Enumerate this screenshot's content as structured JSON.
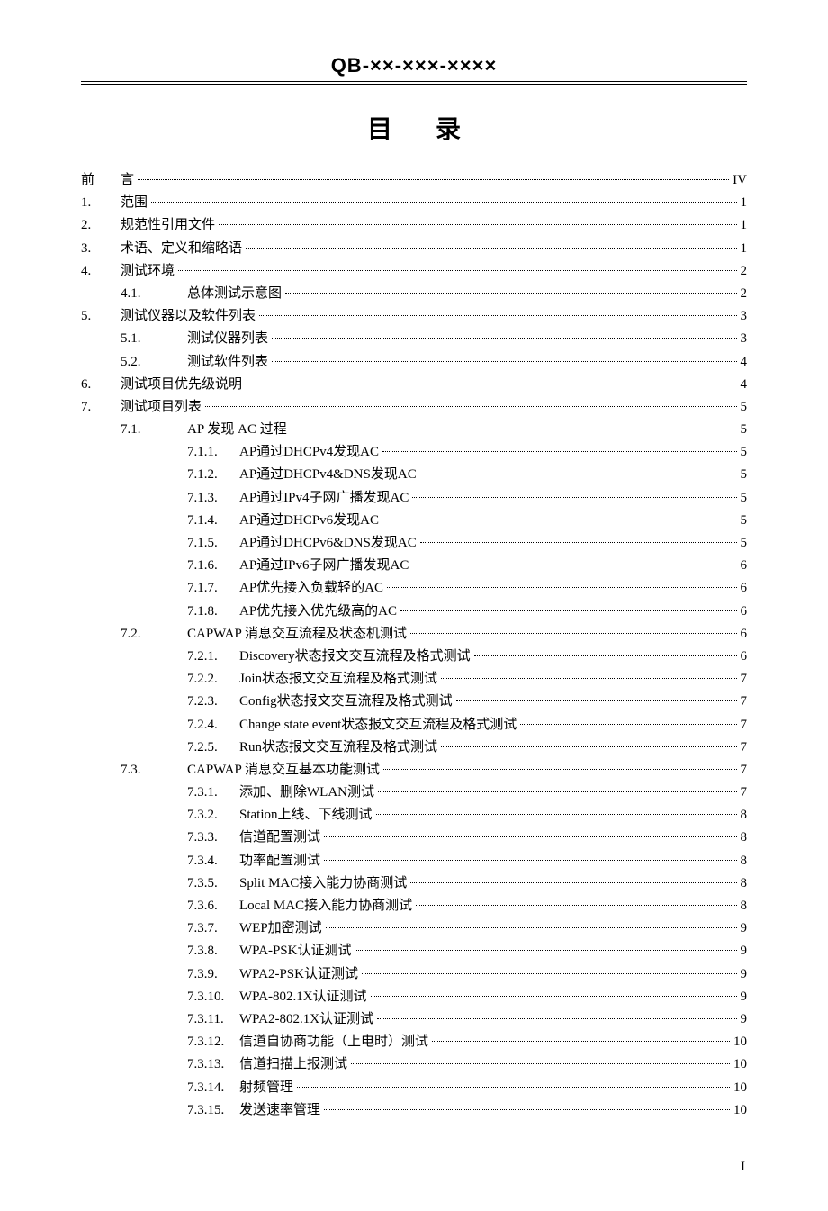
{
  "header_code": "QB-××-×××-××××",
  "toc_title": "目录",
  "footer_page": "I",
  "entries": [
    {
      "level": 0,
      "num": "前",
      "title": "言",
      "page": "IV"
    },
    {
      "level": 0,
      "num": "1.",
      "title": "范围",
      "page": "1"
    },
    {
      "level": 0,
      "num": "2.",
      "title": "规范性引用文件",
      "page": "1"
    },
    {
      "level": 0,
      "num": "3.",
      "title": "术语、定义和缩略语",
      "page": "1"
    },
    {
      "level": 0,
      "num": "4.",
      "title": "测试环境",
      "page": "2"
    },
    {
      "level": 1,
      "num": "4.1.",
      "title": "总体测试示意图",
      "page": "2"
    },
    {
      "level": 0,
      "num": "5.",
      "title": "测试仪器以及软件列表",
      "page": "3"
    },
    {
      "level": 1,
      "num": "5.1.",
      "title": "测试仪器列表",
      "page": "3"
    },
    {
      "level": 1,
      "num": "5.2.",
      "title": "测试软件列表",
      "page": "4"
    },
    {
      "level": 0,
      "num": "6.",
      "title": "测试项目优先级说明",
      "page": "4"
    },
    {
      "level": 0,
      "num": "7.",
      "title": "测试项目列表",
      "page": "5"
    },
    {
      "level": 1,
      "num": "7.1.",
      "title": "AP 发现 AC 过程",
      "page": "5"
    },
    {
      "level": 2,
      "num": "7.1.1.",
      "title": "AP通过DHCPv4发现AC",
      "page": "5"
    },
    {
      "level": 2,
      "num": "7.1.2.",
      "title": "AP通过DHCPv4&DNS发现AC",
      "page": "5"
    },
    {
      "level": 2,
      "num": "7.1.3.",
      "title": "AP通过IPv4子网广播发现AC",
      "page": "5"
    },
    {
      "level": 2,
      "num": "7.1.4.",
      "title": "AP通过DHCPv6发现AC",
      "page": "5"
    },
    {
      "level": 2,
      "num": "7.1.5.",
      "title": "AP通过DHCPv6&DNS发现AC",
      "page": "5"
    },
    {
      "level": 2,
      "num": "7.1.6.",
      "title": "AP通过IPv6子网广播发现AC",
      "page": "6"
    },
    {
      "level": 2,
      "num": "7.1.7.",
      "title": "AP优先接入负载轻的AC",
      "page": "6"
    },
    {
      "level": 2,
      "num": "7.1.8.",
      "title": "AP优先接入优先级高的AC",
      "page": "6"
    },
    {
      "level": 1,
      "num": "7.2.",
      "title": "CAPWAP 消息交互流程及状态机测试",
      "page": "6"
    },
    {
      "level": 2,
      "num": "7.2.1.",
      "title": "Discovery状态报文交互流程及格式测试",
      "page": "6"
    },
    {
      "level": 2,
      "num": "7.2.2.",
      "title": "Join状态报文交互流程及格式测试",
      "page": "7"
    },
    {
      "level": 2,
      "num": "7.2.3.",
      "title": "Config状态报文交互流程及格式测试",
      "page": "7"
    },
    {
      "level": 2,
      "num": "7.2.4.",
      "title": "Change state event状态报文交互流程及格式测试",
      "page": "7"
    },
    {
      "level": 2,
      "num": "7.2.5.",
      "title": "Run状态报文交互流程及格式测试",
      "page": "7"
    },
    {
      "level": 1,
      "num": "7.3.",
      "title": "CAPWAP 消息交互基本功能测试",
      "page": "7"
    },
    {
      "level": 2,
      "num": "7.3.1.",
      "title": "添加、删除WLAN测试",
      "page": "7"
    },
    {
      "level": 2,
      "num": "7.3.2.",
      "title": "Station上线、下线测试",
      "page": "8"
    },
    {
      "level": 2,
      "num": "7.3.3.",
      "title": "信道配置测试",
      "page": "8"
    },
    {
      "level": 2,
      "num": "7.3.4.",
      "title": "功率配置测试",
      "page": "8"
    },
    {
      "level": 2,
      "num": "7.3.5.",
      "title": "Split MAC接入能力协商测试",
      "page": "8"
    },
    {
      "level": 2,
      "num": "7.3.6.",
      "title": "Local MAC接入能力协商测试",
      "page": "8"
    },
    {
      "level": 2,
      "num": "7.3.7.",
      "title": "WEP加密测试",
      "page": "9"
    },
    {
      "level": 2,
      "num": "7.3.8.",
      "title": "WPA-PSK认证测试",
      "page": "9"
    },
    {
      "level": 2,
      "num": "7.3.9.",
      "title": "WPA2-PSK认证测试",
      "page": "9"
    },
    {
      "level": 2,
      "num": "7.3.10.",
      "title": "WPA-802.1X认证测试",
      "page": "9"
    },
    {
      "level": 2,
      "num": "7.3.11.",
      "title": "WPA2-802.1X认证测试",
      "page": "9"
    },
    {
      "level": 2,
      "num": "7.3.12.",
      "title": "信道自协商功能（上电时）测试",
      "page": "10"
    },
    {
      "level": 2,
      "num": "7.3.13.",
      "title": "信道扫描上报测试",
      "page": "10"
    },
    {
      "level": 2,
      "num": "7.3.14.",
      "title": "射频管理",
      "page": "10"
    },
    {
      "level": 2,
      "num": "7.3.15.",
      "title": "发送速率管理",
      "page": "10"
    }
  ]
}
